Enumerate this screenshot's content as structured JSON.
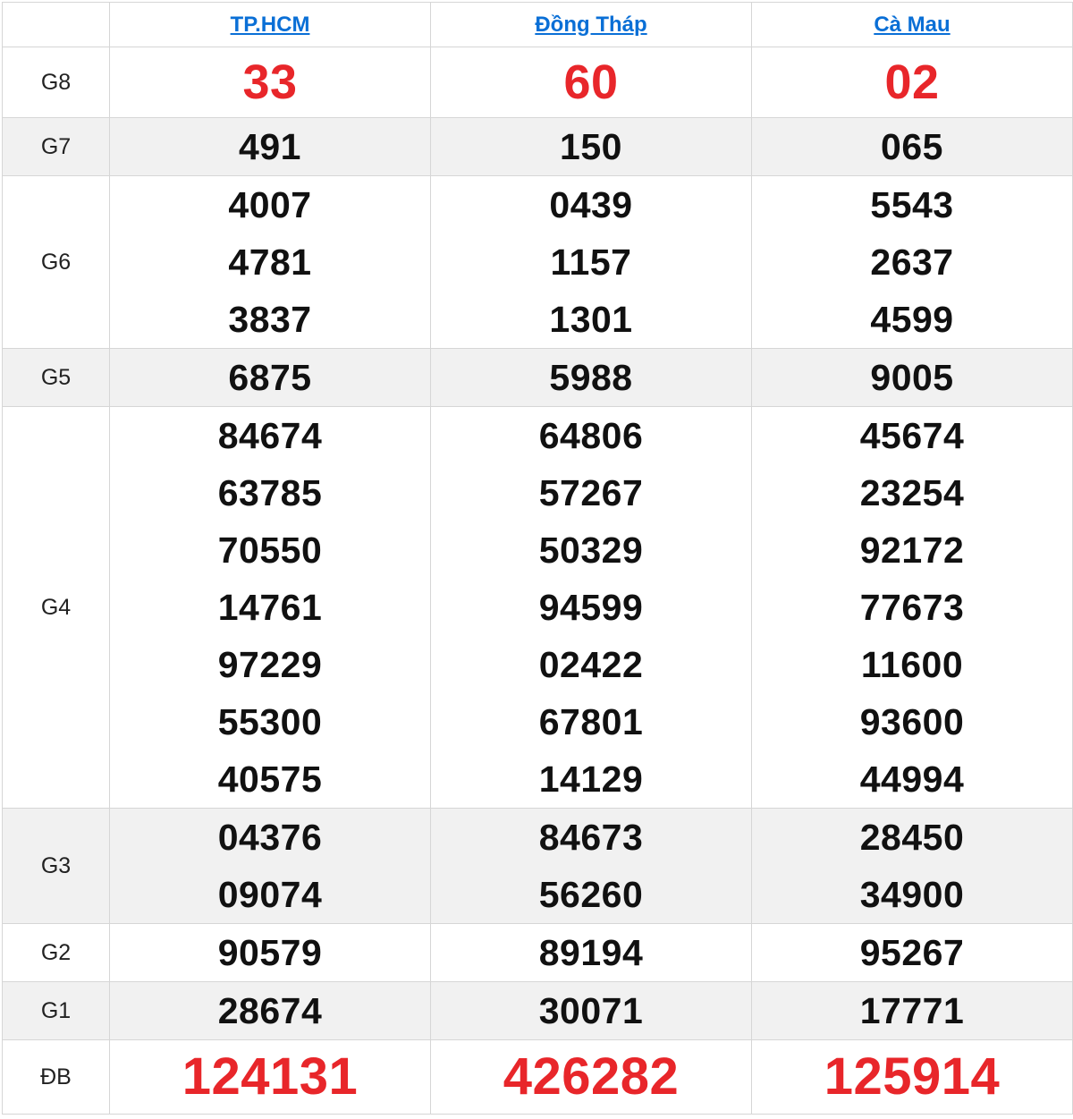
{
  "provinces": [
    "TP.HCM",
    "Đồng Tháp",
    "Cà Mau"
  ],
  "prizes": [
    {
      "label": "G8",
      "values": [
        [
          "33"
        ],
        [
          "60"
        ],
        [
          "02"
        ]
      ]
    },
    {
      "label": "G7",
      "values": [
        [
          "491"
        ],
        [
          "150"
        ],
        [
          "065"
        ]
      ]
    },
    {
      "label": "G6",
      "values": [
        [
          "4007",
          "4781",
          "3837"
        ],
        [
          "0439",
          "1157",
          "1301"
        ],
        [
          "5543",
          "2637",
          "4599"
        ]
      ]
    },
    {
      "label": "G5",
      "values": [
        [
          "6875"
        ],
        [
          "5988"
        ],
        [
          "9005"
        ]
      ]
    },
    {
      "label": "G4",
      "values": [
        [
          "84674",
          "63785",
          "70550",
          "14761",
          "97229",
          "55300",
          "40575"
        ],
        [
          "64806",
          "57267",
          "50329",
          "94599",
          "02422",
          "67801",
          "14129"
        ],
        [
          "45674",
          "23254",
          "92172",
          "77673",
          "11600",
          "93600",
          "44994"
        ]
      ]
    },
    {
      "label": "G3",
      "values": [
        [
          "04376",
          "09074"
        ],
        [
          "84673",
          "56260"
        ],
        [
          "28450",
          "34900"
        ]
      ]
    },
    {
      "label": "G2",
      "values": [
        [
          "90579"
        ],
        [
          "89194"
        ],
        [
          "95267"
        ]
      ]
    },
    {
      "label": "G1",
      "values": [
        [
          "28674"
        ],
        [
          "30071"
        ],
        [
          "17771"
        ]
      ]
    },
    {
      "label": "ĐB",
      "values": [
        [
          "124131"
        ],
        [
          "426282"
        ],
        [
          "125914"
        ]
      ]
    }
  ],
  "colors": {
    "link": "#0a6fd6",
    "highlight": "#e8262a",
    "alt_row": "#f1f1f1"
  }
}
